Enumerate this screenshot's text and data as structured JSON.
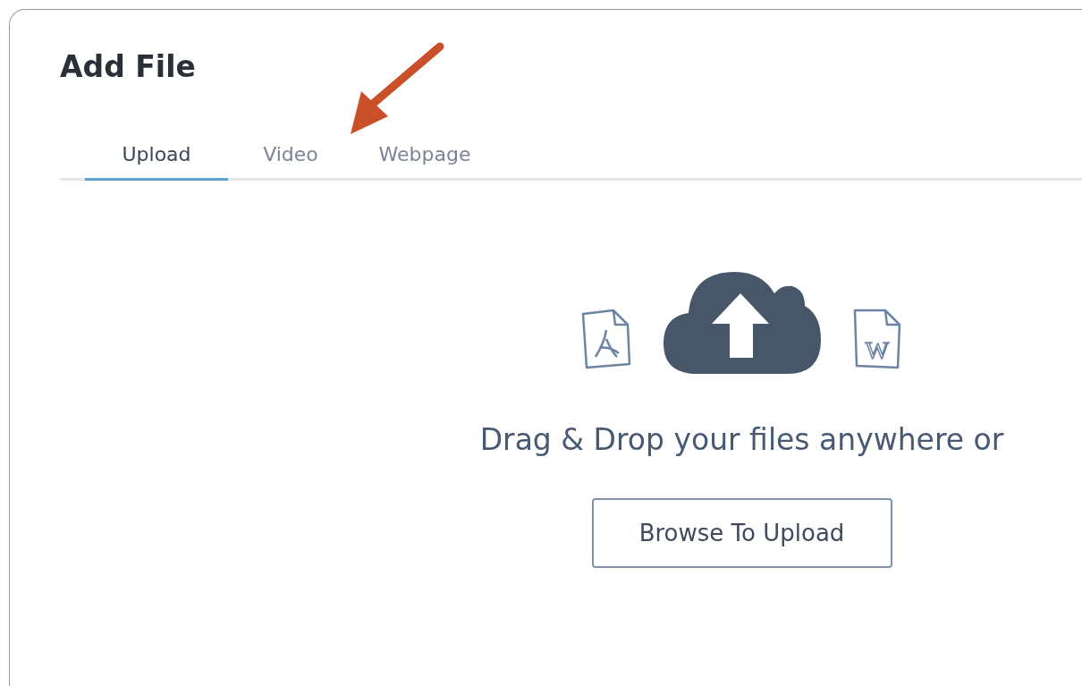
{
  "dialog": {
    "title": "Add File"
  },
  "tabs": [
    {
      "label": "Upload",
      "selected": true
    },
    {
      "label": "Video",
      "selected": false
    },
    {
      "label": "Webpage",
      "selected": false
    }
  ],
  "upload": {
    "word_icon_letter": "W",
    "prompt": "Drag & Drop your files anywhere or",
    "button": "Browse To Upload"
  }
}
